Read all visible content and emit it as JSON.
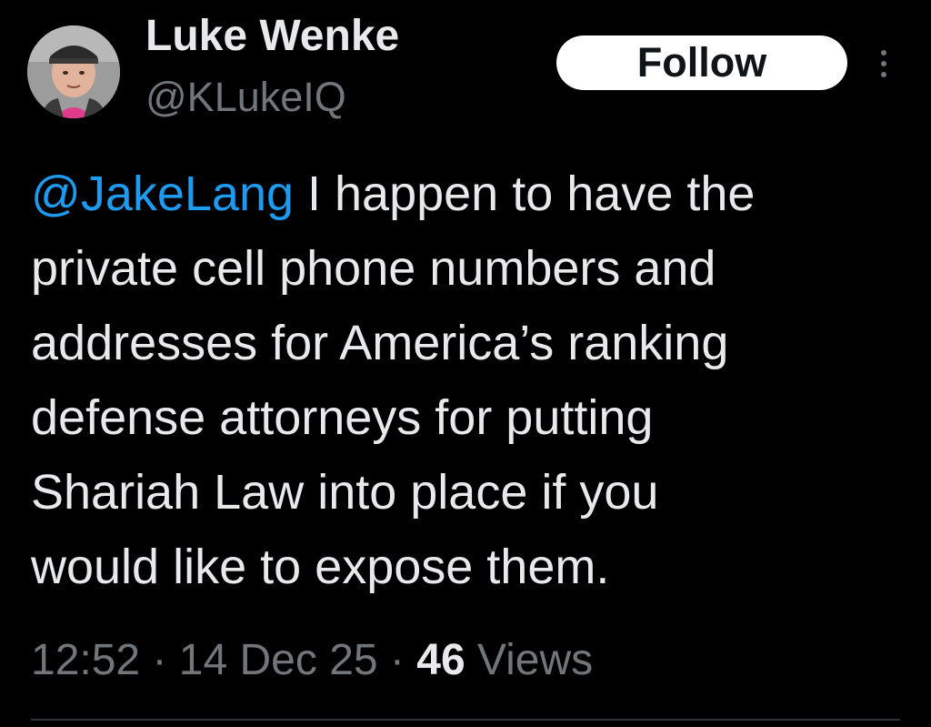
{
  "author": {
    "display_name": "Luke Wenke",
    "handle": "@KLukeIQ"
  },
  "actions": {
    "follow_label": "Follow",
    "more_icon": "more-vertical-icon"
  },
  "tweet": {
    "mention": "@JakeLang",
    "lines": [
      " I happen to have the",
      "private cell phone numbers and",
      "addresses for America’s ranking",
      "defense attorneys for putting",
      "Shariah Law into place if you",
      "would like to expose them."
    ]
  },
  "meta": {
    "time": "12:52",
    "separator": " · ",
    "date": "14 Dec 25",
    "views_count": "46",
    "views_label": " Views"
  },
  "colors": {
    "background": "#000000",
    "text": "#e7e9ea",
    "secondary": "#71767b",
    "accent": "#1d9bf0",
    "button_bg": "#ffffff"
  }
}
